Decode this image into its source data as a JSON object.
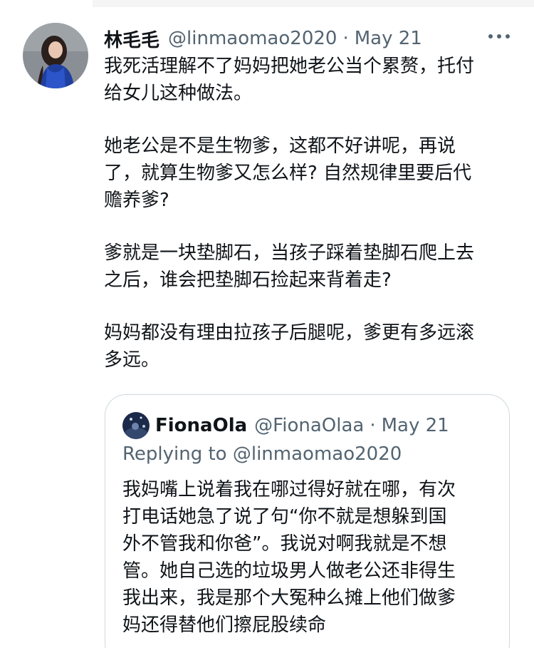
{
  "tweet": {
    "display_name": "林毛毛",
    "handle": "@linmaomao2020",
    "separator": "·",
    "date": "May 21",
    "paragraphs": [
      "我死活理解不了妈妈把她老公当个累赘，托付\n给女儿这种做法。",
      "她老公是不是生物爹，这都不好讲呢，再说\n了，就算生物爹又怎么样? 自然规律里要后代\n赡养爹?",
      "爹就是一块垫脚石，当孩子踩着垫脚石爬上去\n之后，谁会把垫脚石捡起来背着走?",
      "妈妈都没有理由拉孩子后腿呢，爹更有多远滚\n多远。"
    ],
    "icons": {
      "avatar": "profile-avatar",
      "more": "more-icon"
    }
  },
  "quoted_tweet": {
    "display_name": "FionaOla",
    "handle": "@FionaOlaa",
    "separator": "·",
    "date": "May 21",
    "replying_to": "Replying to @linmaomao2020",
    "text": "我妈嘴上说着我在哪过得好就在哪，有次\n打电话她急了说了句“你不就是想躲到国\n外不管我和你爸”。我说对啊我就是不想\n管。她自己选的垃圾男人做老公还非得生\n我出来，我是那个大冤种么摊上他们做爹\n妈还得替他们擦屁股续命"
  },
  "colors": {
    "text_primary": "#0f1419",
    "text_secondary": "#536471",
    "border": "#cfd9de"
  }
}
